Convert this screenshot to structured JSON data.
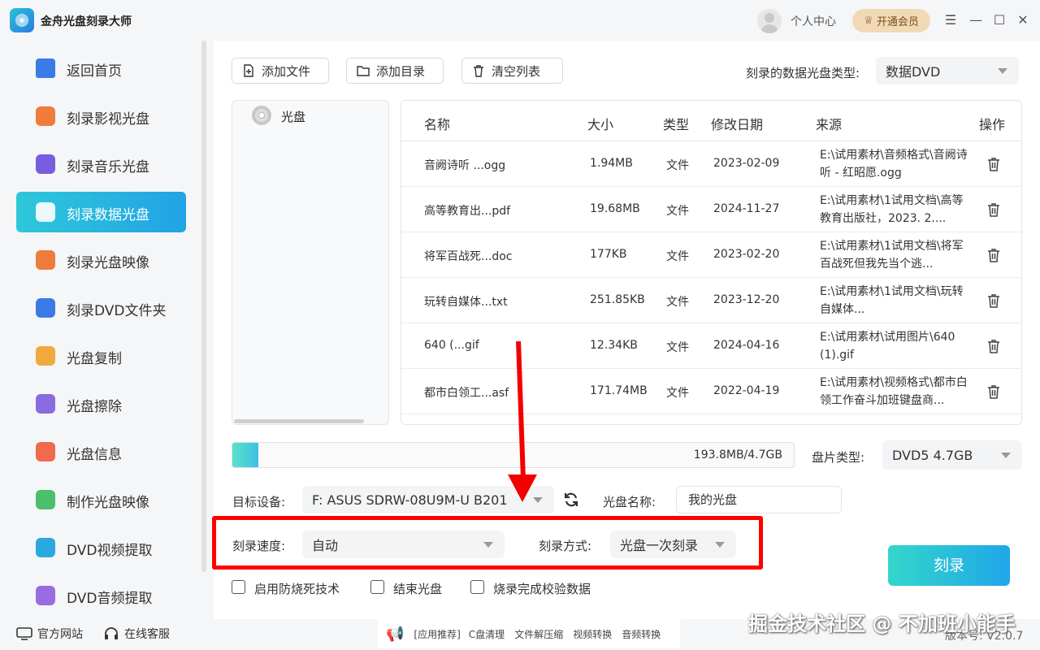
{
  "app": {
    "title": "金舟光盘刻录大师",
    "user_center": "个人中心",
    "vip_label": "开通会员"
  },
  "sidebar": {
    "items": [
      {
        "label": "返回首页",
        "icon": "home-icon",
        "color": "#3b7be8"
      },
      {
        "label": "刻录影视光盘",
        "icon": "video-disc-icon",
        "color": "#f07c3c"
      },
      {
        "label": "刻录音乐光盘",
        "icon": "music-disc-icon",
        "color": "#7a5ce0"
      },
      {
        "label": "刻录数据光盘",
        "icon": "data-disc-icon",
        "color": "#ffffff"
      },
      {
        "label": "刻录光盘映像",
        "icon": "disc-image-icon",
        "color": "#f07c3c"
      },
      {
        "label": "刻录DVD文件夹",
        "icon": "dvd-folder-icon",
        "color": "#3b7be8"
      },
      {
        "label": "光盘复制",
        "icon": "disc-copy-icon",
        "color": "#f0a93c"
      },
      {
        "label": "光盘擦除",
        "icon": "disc-erase-icon",
        "color": "#8b6be0"
      },
      {
        "label": "光盘信息",
        "icon": "disc-info-icon",
        "color": "#f06a4c"
      },
      {
        "label": "制作光盘映像",
        "icon": "make-image-icon",
        "color": "#4cbf6a"
      },
      {
        "label": "DVD视频提取",
        "icon": "dvd-video-extract-icon",
        "color": "#2aa9e0"
      },
      {
        "label": "DVD音频提取",
        "icon": "dvd-audio-extract-icon",
        "color": "#9b6be0"
      }
    ]
  },
  "toolbar": {
    "add_file": "添加文件",
    "add_dir": "添加目录",
    "clear_list": "清空列表",
    "disc_type_label": "刻录的数据光盘类型:",
    "disc_type_value": "数据DVD"
  },
  "tree": {
    "root": "光盘"
  },
  "table": {
    "headers": {
      "name": "名称",
      "size": "大小",
      "type": "类型",
      "date": "修改日期",
      "source": "来源",
      "action": "操作"
    },
    "rows": [
      {
        "name": "音阙诗听 ...ogg",
        "size": "1.94MB",
        "type": "文件",
        "date": "2023-02-09",
        "source": "E:\\试用素材\\音频格式\\音阙诗听 - 红昭愿.ogg"
      },
      {
        "name": "高等教育出...pdf",
        "size": "19.68MB",
        "type": "文件",
        "date": "2024-11-27",
        "source": "E:\\试用素材\\1试用文档\\高等教育出版社，2023. 2...."
      },
      {
        "name": "将军百战死...doc",
        "size": "177KB",
        "type": "文件",
        "date": "2023-02-20",
        "source": "E:\\试用素材\\1试用文档\\将军百战死但我先当个逃..."
      },
      {
        "name": "玩转自媒体...txt",
        "size": "251.85KB",
        "type": "文件",
        "date": "2023-12-20",
        "source": "E:\\试用素材\\1试用文档\\玩转自媒体..."
      },
      {
        "name": "640 (...gif",
        "size": "12.34KB",
        "type": "文件",
        "date": "2024-04-16",
        "source": "E:\\试用素材\\试用图片\\640 (1).gif"
      },
      {
        "name": "都市白领工...asf",
        "size": "171.74MB",
        "type": "文件",
        "date": "2022-04-19",
        "source": "E:\\试用素材\\视频格式\\都市白领工作奋斗加班键盘商..."
      }
    ]
  },
  "capacity": {
    "text": "193.8MB/4.7GB",
    "used_fraction": 0.04,
    "disc_type_label": "盘片类型:",
    "disc_type_value": "DVD5 4.7GB"
  },
  "settings": {
    "device_label": "目标设备:",
    "device_value": "F: ASUS SDRW-08U9M-U B201",
    "disc_name_label": "光盘名称:",
    "disc_name_value": "我的光盘",
    "speed_label": "刻录速度:",
    "speed_value": "自动",
    "mode_label": "刻录方式:",
    "mode_value": "光盘一次刻录",
    "burn_button": "刻录",
    "options": [
      "启用防烧死技术",
      "结束光盘",
      "烧录完成校验数据"
    ]
  },
  "footer": {
    "website": "官方网站",
    "support": "在线客服",
    "tools": [
      "[应用推荐]",
      "C盘清理",
      "文件解压缩",
      "视频转换",
      "音频转换"
    ],
    "watermark": "掘金技术社区 @ 不加班小能手",
    "version": "版本号: V2.0.7"
  }
}
